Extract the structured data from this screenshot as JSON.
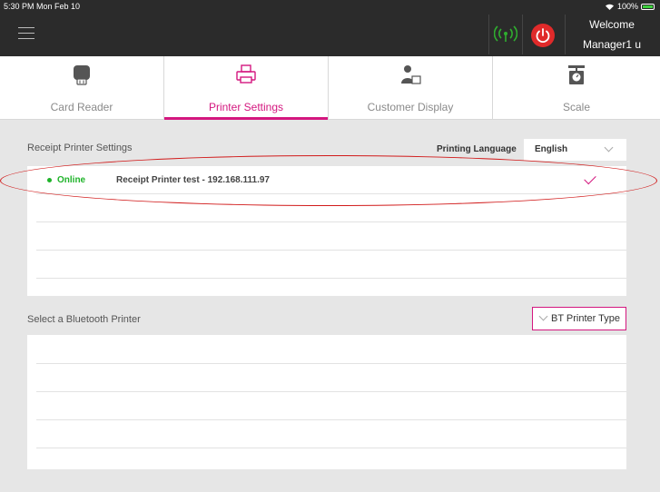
{
  "status_bar": {
    "time": "5:30 PM  Mon Feb 10",
    "battery": "100%"
  },
  "header": {
    "welcome": "Welcome",
    "user": "Manager1 u"
  },
  "tabs": [
    {
      "label": "Card Reader",
      "icon": "card-reader-icon"
    },
    {
      "label": "Printer Settings",
      "icon": "printer-icon"
    },
    {
      "label": "Customer Display",
      "icon": "customer-display-icon"
    },
    {
      "label": "Scale",
      "icon": "scale-icon"
    }
  ],
  "receipt": {
    "title": "Receipt Printer Settings",
    "language_label": "Printing Language",
    "language_value": "English",
    "printers": [
      {
        "status": "Online",
        "name": "Receipt Printer test - 192.168.111.97",
        "selected": true
      }
    ]
  },
  "bluetooth": {
    "title": "Select a Bluetooth Printer",
    "type_button": "BT Printer Type"
  },
  "colors": {
    "accent": "#d4177f",
    "online": "#1fb32a",
    "power": "#e02a2a",
    "annotation": "#d11a1a"
  }
}
